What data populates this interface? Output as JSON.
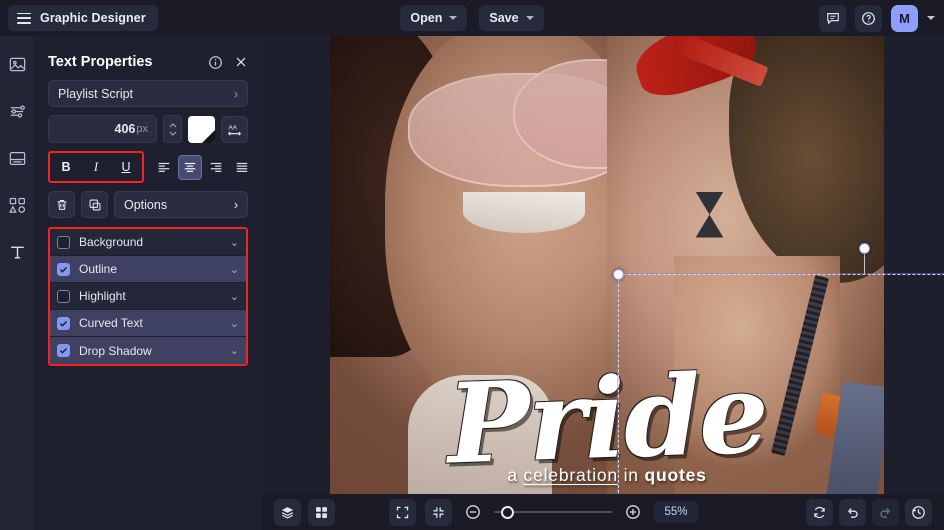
{
  "app": {
    "title": "Graphic Designer",
    "menu_icon": "hamburger-icon"
  },
  "topbar": {
    "open_label": "Open",
    "save_label": "Save",
    "comment_icon": "comment-icon",
    "help_icon": "help-circle-icon",
    "avatar_initial": "M"
  },
  "rail": {
    "items": [
      {
        "icon": "image-icon",
        "name": "image-tool"
      },
      {
        "icon": "sliders-icon",
        "name": "adjustments-tool"
      },
      {
        "icon": "layout-icon",
        "name": "layout-tool"
      },
      {
        "icon": "shapes-icon",
        "name": "shapes-tool"
      },
      {
        "icon": "text-icon",
        "name": "text-tool"
      }
    ]
  },
  "panel": {
    "title": "Text Properties",
    "info_icon": "info-circle-icon",
    "close_icon": "close-icon",
    "font_family": "Playlist Script",
    "font_family_chevron": "›",
    "font_size": "406",
    "font_size_unit": "px",
    "color_swatch_hex": "#ffffff",
    "letter_spacing_icon": "letter-spacing-icon",
    "bold_label": "B",
    "italic_label": "I",
    "underline_label": "U",
    "align_options": [
      "align-left",
      "align-center",
      "align-right",
      "align-justify"
    ],
    "align_selected": "align-center",
    "delete_icon": "trash-icon",
    "duplicate_icon": "duplicate-icon",
    "options_label": "Options",
    "options_chevron": "›",
    "effects": [
      {
        "label": "Background",
        "checked": false,
        "chevron": "⌄"
      },
      {
        "label": "Outline",
        "checked": true,
        "chevron": "⌄"
      },
      {
        "label": "Highlight",
        "checked": false,
        "chevron": "⌄"
      },
      {
        "label": "Curved Text",
        "checked": true,
        "chevron": "⌄"
      },
      {
        "label": "Drop Shadow",
        "checked": true,
        "chevron": "⌄"
      }
    ],
    "highlight_color": "#f3231f",
    "accent_color": "#8597f0"
  },
  "canvas": {
    "headline": "Pride",
    "sub_pre": "a ",
    "sub_underlined": "celebration",
    "sub_mid": " in ",
    "sub_bold": "quotes"
  },
  "bottombar": {
    "layers_icon": "layers-icon",
    "grid_icon": "grid-icon",
    "fit_icon": "fit-screen-icon",
    "collapse_icon": "collapse-icon",
    "zoom_out_icon": "zoom-out-icon",
    "zoom_in_icon": "zoom-in-icon",
    "zoom_value": "55%",
    "reset_icon": "refresh-icon",
    "undo_icon": "undo-icon",
    "redo_icon": "redo-icon",
    "history_icon": "history-icon"
  }
}
